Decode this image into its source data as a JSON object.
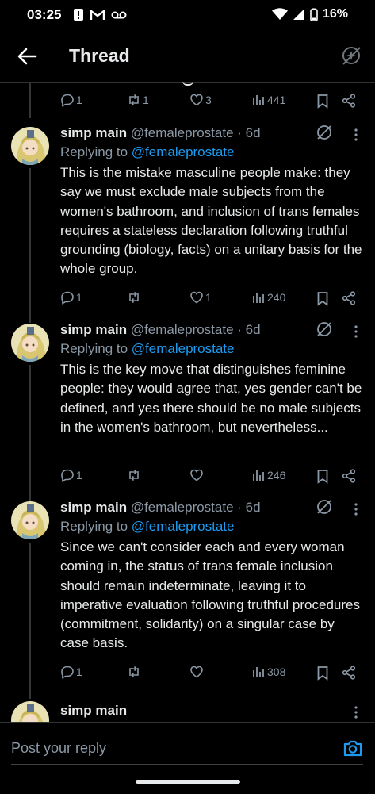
{
  "status_bar": {
    "time": "03:25",
    "battery": "16%"
  },
  "header": {
    "title": "Thread"
  },
  "top_stats": {
    "replies": "1",
    "reposts": "1",
    "likes": "3",
    "views": "441"
  },
  "tweets": [
    {
      "name": "simp main",
      "handle": "@femaleprostate · 6d",
      "replying_prefix": "Replying to ",
      "replying_to": "@femaleprostate",
      "text": "This is the mistake masculine people make: they say we must exclude male subjects from the women's bathroom, and inclusion of trans females requires a stateless declaration following truthful grounding (biology, facts) on a unitary basis for the whole group.",
      "replies": "1",
      "reposts": "",
      "likes": "1",
      "views": "240"
    },
    {
      "name": "simp main",
      "handle": "@femaleprostate · 6d",
      "replying_prefix": "Replying to ",
      "replying_to": "@femaleprostate",
      "text": "This is the key move that distinguishes feminine people: they would agree that, yes gender can't be defined, and yes there should be no male subjects in the women's bathroom, but nevertheless...",
      "replies": "1",
      "reposts": "",
      "likes": "",
      "views": "246"
    },
    {
      "name": "simp main",
      "handle": "@femaleprostate · 6d",
      "replying_prefix": "Replying to ",
      "replying_to": "@femaleprostate",
      "text": "Since we can't consider each and every woman coming in, the status of trans female inclusion should remain indeterminate, leaving it to imperative evaluation following truthful procedures (commitment, solidarity) on a singular case by case basis.",
      "replies": "1",
      "reposts": "",
      "likes": "",
      "views": "308"
    }
  ],
  "partial_tweet": {
    "name": "simp main"
  },
  "composer": {
    "placeholder": "Post your reply"
  },
  "colors": {
    "accent": "#1d9bf0",
    "muted": "#8b98a5",
    "background": "#000000"
  }
}
